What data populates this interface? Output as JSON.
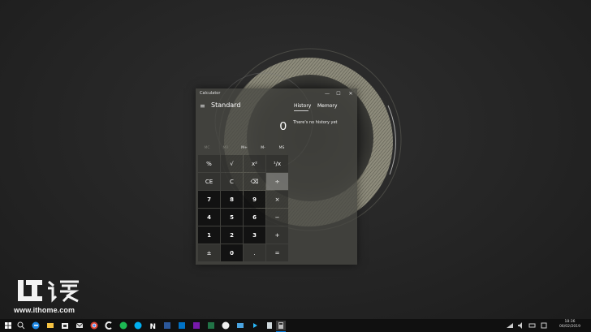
{
  "watermark": {
    "url": "www.ithome.com"
  },
  "calculator": {
    "window_title": "Calculator",
    "minimize": "—",
    "maximize": "☐",
    "close": "✕",
    "menu_icon": "≡",
    "mode": "Standard",
    "tabs": {
      "history": "History",
      "memory": "Memory"
    },
    "display": "0",
    "history_empty": "There's no history yet",
    "memory_buttons": [
      "MC",
      "MR",
      "M+",
      "M-",
      "MS"
    ],
    "keys": [
      [
        "%",
        "√",
        "x²",
        "¹/x"
      ],
      [
        "CE",
        "C",
        "⌫",
        "÷"
      ],
      [
        "7",
        "8",
        "9",
        "×"
      ],
      [
        "4",
        "5",
        "6",
        "−"
      ],
      [
        "1",
        "2",
        "3",
        "+"
      ],
      [
        "±",
        "0",
        ".",
        "="
      ]
    ]
  },
  "taskbar": {
    "time": "18:36",
    "date": "06/02/2019",
    "pinned_icons": [
      "search-icon",
      "task-view-icon",
      "edge-icon",
      "file-explorer-icon",
      "store-icon",
      "mail-icon",
      "chrome-icon",
      "ccleaner-icon",
      "spotify-icon",
      "skype-icon",
      "notion-icon",
      "word-icon",
      "outlook-icon",
      "onenote-icon",
      "excel-icon",
      "xbox-icon",
      "photos-icon",
      "media-player-icon",
      "snip-icon",
      "notepad-icon",
      "calculator-icon"
    ],
    "colors": {
      "accent": "#0078d7",
      "taskbar_bg": "#101010"
    }
  }
}
